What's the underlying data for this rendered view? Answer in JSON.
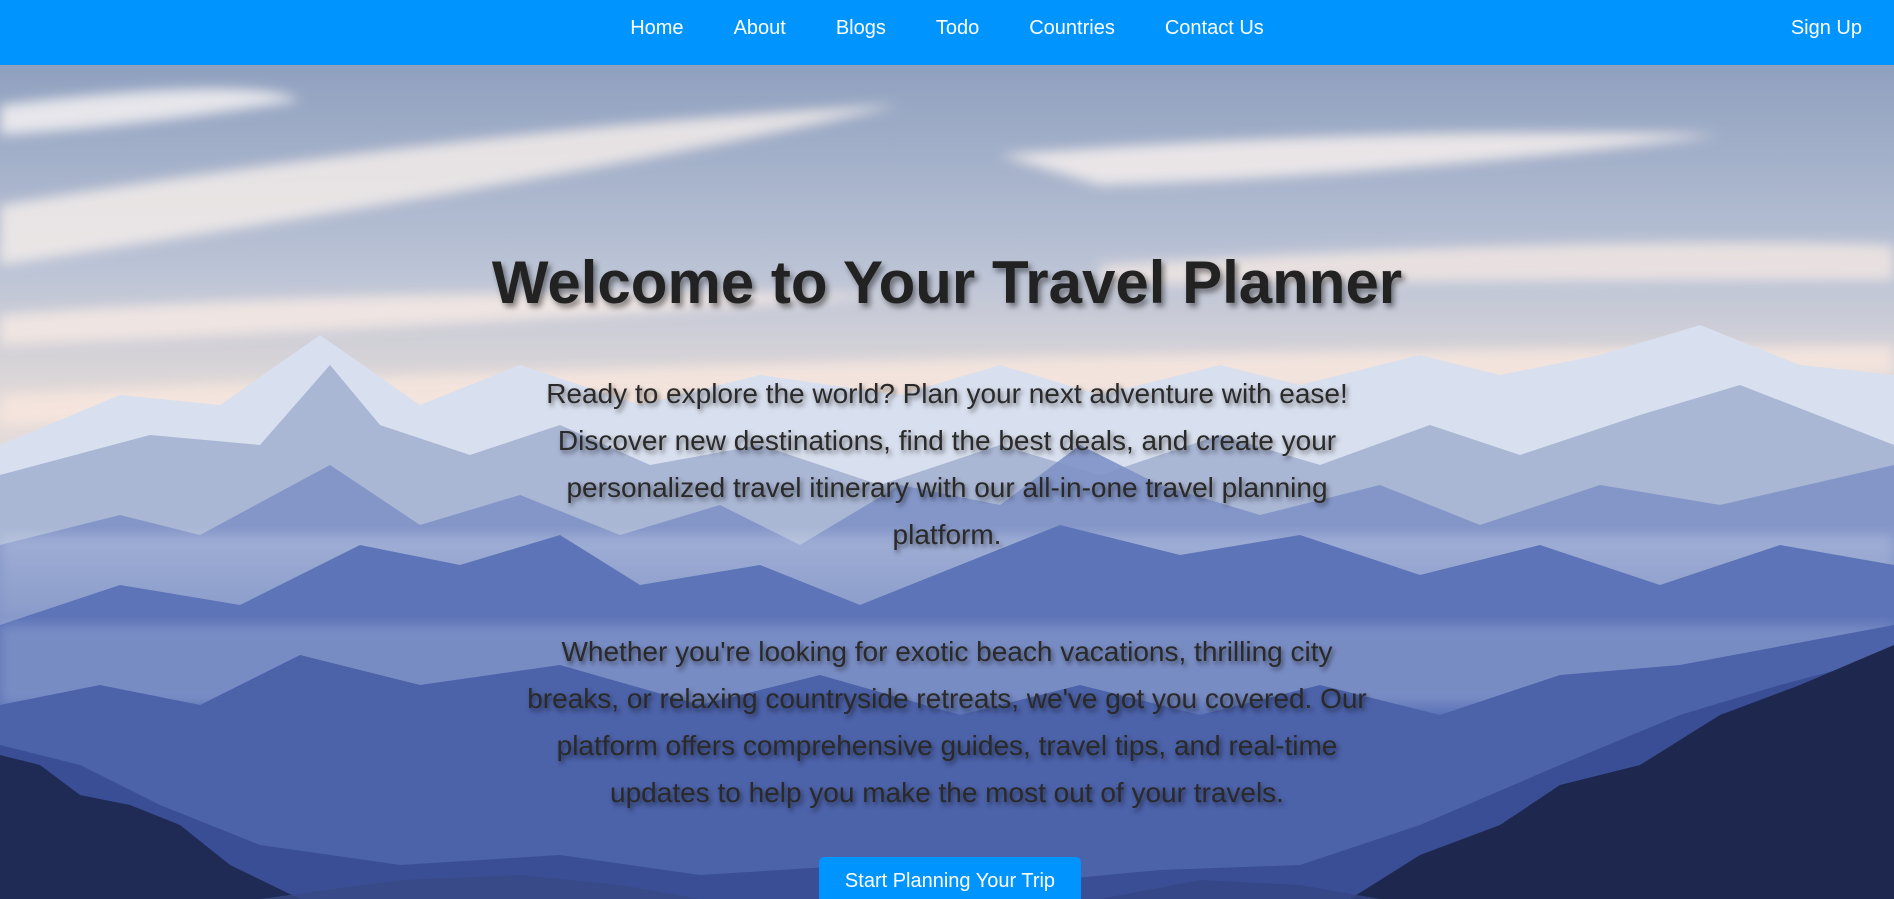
{
  "nav": {
    "items": [
      {
        "label": "Home"
      },
      {
        "label": "About"
      },
      {
        "label": "Blogs"
      },
      {
        "label": "Todo"
      },
      {
        "label": "Countries"
      },
      {
        "label": "Contact Us"
      }
    ],
    "signup_label": "Sign Up"
  },
  "hero": {
    "title": "Welcome to Your Travel Planner",
    "paragraph1": "Ready to explore the world? Plan your next adventure with ease! Discover new destinations, find the best deals, and create your personalized travel itinerary with our all-in-one travel planning platform.",
    "paragraph2": "Whether you're looking for exotic beach vacations, thrilling city breaks, or relaxing countryside retreats, we've got you covered. Our platform offers comprehensive guides, travel tips, and real-time updates to help you make the most out of your travels.",
    "cta_label": "Start Planning Your Trip"
  },
  "colors": {
    "nav_bg": "#0094ff",
    "button_bg": "#0094ff",
    "text": "#222222"
  }
}
